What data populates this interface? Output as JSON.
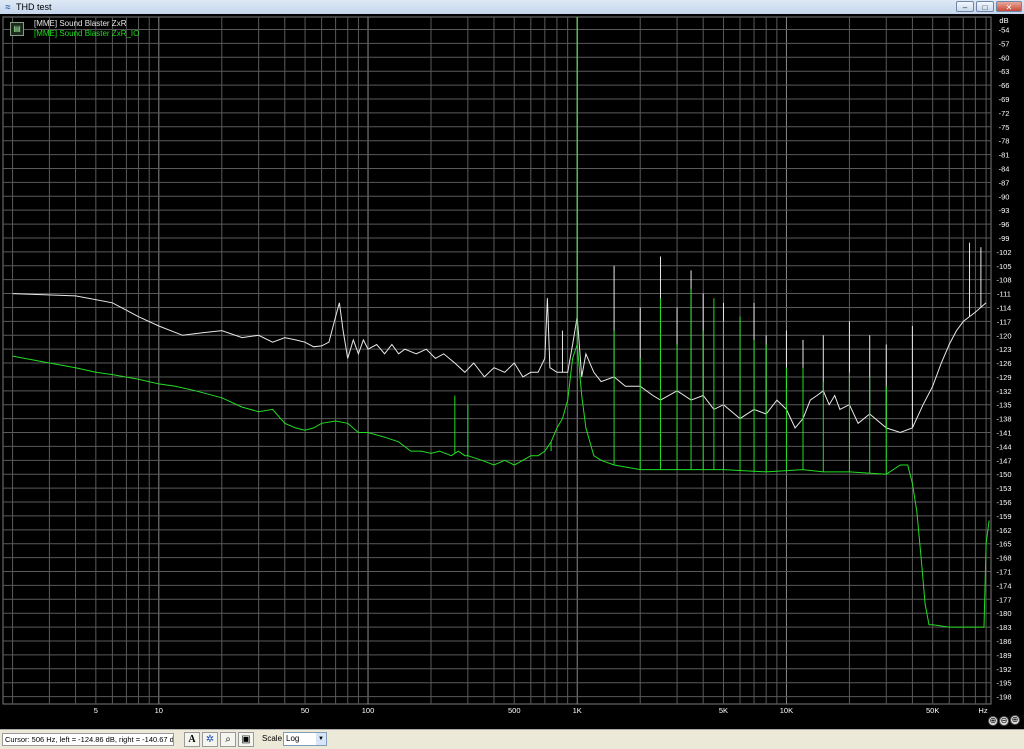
{
  "window": {
    "title": "THD test",
    "icon": "analyzer-icon",
    "controls": {
      "minimize": "–",
      "maximize": "□",
      "close": "✕"
    }
  },
  "legend": {
    "icon": "traces-icon",
    "entries": [
      {
        "label": "[MME] Sound Blaster ZxR",
        "color": "#e8e8e8"
      },
      {
        "label": "[MME] Sound Blaster ZxR_IO",
        "color": "#22dd22"
      }
    ]
  },
  "chart_data": {
    "type": "line",
    "title": "",
    "xlabel": "Hz",
    "ylabel": "dB",
    "xscale": "log",
    "xlim": [
      1.8,
      95000
    ],
    "ylim": [
      -199.6,
      -51.3
    ],
    "grid": true,
    "background": "#000000",
    "grid_color": "#5a5a5a",
    "x_tick_labels": [
      {
        "value": 5,
        "label": "5"
      },
      {
        "value": 10,
        "label": "10"
      },
      {
        "value": 50,
        "label": "50"
      },
      {
        "value": 100,
        "label": "100"
      },
      {
        "value": 500,
        "label": "500"
      },
      {
        "value": 1000,
        "label": "1K"
      },
      {
        "value": 5000,
        "label": "5K"
      },
      {
        "value": 10000,
        "label": "10K"
      },
      {
        "value": 50000,
        "label": "50K"
      }
    ],
    "x_unit_label": "Hz",
    "y_unit_label": "dB",
    "y_tick_labels": [
      "-54",
      "-57",
      "-60",
      "-63",
      "-66",
      "-69",
      "-72",
      "-75",
      "-78",
      "-81",
      "-84",
      "-87",
      "-90",
      "-93",
      "-96",
      "-99",
      "-102",
      "-105",
      "-108",
      "-111",
      "-114",
      "-117",
      "-120",
      "-123",
      "-126",
      "-129",
      "-132",
      "-135",
      "-138",
      "-141",
      "-144",
      "-147",
      "-150",
      "-153",
      "-156",
      "-159",
      "-162",
      "-165",
      "-168",
      "-171",
      "-174",
      "-177",
      "-180",
      "-183",
      "-186",
      "-189",
      "-192",
      "-195",
      "-198"
    ],
    "series": [
      {
        "name": "[MME] Sound Blaster ZxR",
        "color": "#e8e8e8",
        "points": [
          [
            2,
            -111.0
          ],
          [
            4,
            -111.5
          ],
          [
            6,
            -113
          ],
          [
            8,
            -116
          ],
          [
            10,
            -118
          ],
          [
            13,
            -120
          ],
          [
            16,
            -119.5
          ],
          [
            20,
            -119
          ],
          [
            25,
            -120.5
          ],
          [
            30,
            -120
          ],
          [
            35,
            -121.5
          ],
          [
            40,
            -120.5
          ],
          [
            45,
            -121
          ],
          [
            50,
            -121.5
          ],
          [
            55,
            -122.5
          ],
          [
            60,
            -122.3
          ],
          [
            65,
            -121.5
          ],
          [
            70,
            -116
          ],
          [
            73,
            -113
          ],
          [
            76,
            -119
          ],
          [
            80,
            -125
          ],
          [
            85,
            -121
          ],
          [
            90,
            -124
          ],
          [
            95,
            -121
          ],
          [
            100,
            -123
          ],
          [
            110,
            -122
          ],
          [
            120,
            -124
          ],
          [
            130,
            -122
          ],
          [
            140,
            -124
          ],
          [
            150,
            -123
          ],
          [
            170,
            -124
          ],
          [
            190,
            -123
          ],
          [
            210,
            -125
          ],
          [
            230,
            -124
          ],
          [
            260,
            -126
          ],
          [
            290,
            -128
          ],
          [
            320,
            -126
          ],
          [
            360,
            -129
          ],
          [
            400,
            -127
          ],
          [
            450,
            -128
          ],
          [
            500,
            -126
          ],
          [
            550,
            -129
          ],
          [
            600,
            -128
          ],
          [
            650,
            -128
          ],
          [
            700,
            -125
          ],
          [
            720,
            -112
          ],
          [
            740,
            -127
          ],
          [
            800,
            -128
          ],
          [
            900,
            -128
          ],
          [
            950,
            -122
          ],
          [
            1000,
            -116
          ],
          [
            1050,
            -129
          ],
          [
            1100,
            -124
          ],
          [
            1200,
            -128
          ],
          [
            1300,
            -130
          ],
          [
            1500,
            -129
          ],
          [
            1700,
            -131
          ],
          [
            2000,
            -131
          ],
          [
            2300,
            -133
          ],
          [
            2500,
            -134
          ],
          [
            3000,
            -132
          ],
          [
            3500,
            -134
          ],
          [
            4000,
            -133
          ],
          [
            4500,
            -136
          ],
          [
            5000,
            -135
          ],
          [
            6000,
            -138
          ],
          [
            7000,
            -136
          ],
          [
            8000,
            -137
          ],
          [
            9000,
            -134
          ],
          [
            10000,
            -136
          ],
          [
            11000,
            -140
          ],
          [
            12000,
            -138
          ],
          [
            13000,
            -134
          ],
          [
            14000,
            -133
          ],
          [
            15000,
            -132
          ],
          [
            16000,
            -135
          ],
          [
            17000,
            -133
          ],
          [
            18000,
            -136
          ],
          [
            20000,
            -135
          ],
          [
            22000,
            -139
          ],
          [
            25000,
            -137
          ],
          [
            30000,
            -140
          ],
          [
            35000,
            -141
          ],
          [
            40000,
            -140
          ],
          [
            45000,
            -135
          ],
          [
            50000,
            -131
          ],
          [
            55000,
            -126
          ],
          [
            60000,
            -122
          ],
          [
            65000,
            -119
          ],
          [
            70000,
            -117
          ],
          [
            80000,
            -115
          ],
          [
            90000,
            -113
          ]
        ],
        "spikes": [
          [
            720,
            -112
          ],
          [
            850,
            -119
          ],
          [
            1000,
            -51.3
          ],
          [
            1500,
            -105
          ],
          [
            2000,
            -114
          ],
          [
            2500,
            -103
          ],
          [
            3000,
            -114
          ],
          [
            3500,
            -106
          ],
          [
            4000,
            -111
          ],
          [
            5000,
            -113
          ],
          [
            6000,
            -116
          ],
          [
            7000,
            -113
          ],
          [
            8000,
            -120
          ],
          [
            10000,
            -119
          ],
          [
            12000,
            -121
          ],
          [
            15000,
            -120
          ],
          [
            20000,
            -117
          ],
          [
            25000,
            -120
          ],
          [
            30000,
            -122
          ],
          [
            40000,
            -118
          ],
          [
            75000,
            -100
          ],
          [
            85000,
            -101
          ]
        ]
      },
      {
        "name": "[MME] Sound Blaster ZxR_IO",
        "color": "#22dd22",
        "points": [
          [
            2,
            -124.5
          ],
          [
            3,
            -126
          ],
          [
            4,
            -127
          ],
          [
            5,
            -128
          ],
          [
            6,
            -128.5
          ],
          [
            8,
            -129.5
          ],
          [
            10,
            -130.5
          ],
          [
            12,
            -131
          ],
          [
            15,
            -132
          ],
          [
            20,
            -133.5
          ],
          [
            25,
            -135.5
          ],
          [
            30,
            -136.5
          ],
          [
            35,
            -136
          ],
          [
            40,
            -139
          ],
          [
            45,
            -140
          ],
          [
            50,
            -140.5
          ],
          [
            55,
            -140
          ],
          [
            60,
            -139
          ],
          [
            70,
            -138.5
          ],
          [
            80,
            -139
          ],
          [
            90,
            -141
          ],
          [
            100,
            -141
          ],
          [
            120,
            -142
          ],
          [
            140,
            -143
          ],
          [
            160,
            -145
          ],
          [
            180,
            -145
          ],
          [
            200,
            -145.5
          ],
          [
            220,
            -145
          ],
          [
            250,
            -146
          ],
          [
            270,
            -145
          ],
          [
            290,
            -146
          ],
          [
            300,
            -146
          ],
          [
            350,
            -147
          ],
          [
            400,
            -148
          ],
          [
            450,
            -147
          ],
          [
            500,
            -148
          ],
          [
            550,
            -147
          ],
          [
            600,
            -146
          ],
          [
            650,
            -146
          ],
          [
            700,
            -145
          ],
          [
            750,
            -143
          ],
          [
            800,
            -140
          ],
          [
            850,
            -138
          ],
          [
            900,
            -134
          ],
          [
            950,
            -125
          ],
          [
            1000,
            -122
          ],
          [
            1050,
            -133
          ],
          [
            1100,
            -140
          ],
          [
            1200,
            -146
          ],
          [
            1300,
            -147
          ],
          [
            1500,
            -148
          ],
          [
            2000,
            -149
          ],
          [
            3000,
            -149
          ],
          [
            5000,
            -149
          ],
          [
            8000,
            -149.5
          ],
          [
            12000,
            -149
          ],
          [
            15000,
            -149.5
          ],
          [
            20000,
            -149.5
          ],
          [
            30000,
            -150
          ],
          [
            35000,
            -148
          ],
          [
            38000,
            -148
          ],
          [
            40000,
            -152
          ],
          [
            42000,
            -158
          ],
          [
            44000,
            -168
          ],
          [
            46000,
            -178
          ],
          [
            48000,
            -182.5
          ],
          [
            50000,
            -182.5
          ],
          [
            60000,
            -183
          ],
          [
            70000,
            -183
          ],
          [
            80000,
            -183
          ],
          [
            88000,
            -183
          ],
          [
            90000,
            -165
          ],
          [
            93000,
            -160
          ]
        ],
        "spikes": [
          [
            260,
            -133
          ],
          [
            300,
            -135
          ],
          [
            750,
            -145
          ],
          [
            1000,
            -51.3
          ],
          [
            1500,
            -119
          ],
          [
            2000,
            -125
          ],
          [
            2500,
            -112
          ],
          [
            3000,
            -122
          ],
          [
            3500,
            -110
          ],
          [
            4000,
            -119
          ],
          [
            4500,
            -112
          ],
          [
            5000,
            -117
          ],
          [
            6000,
            -116
          ],
          [
            7000,
            -121
          ],
          [
            8000,
            -122
          ],
          [
            10000,
            -127
          ],
          [
            12000,
            -127
          ],
          [
            15000,
            -130
          ],
          [
            20000,
            -128
          ],
          [
            25000,
            -129
          ],
          [
            30000,
            -131
          ]
        ]
      }
    ]
  },
  "status": {
    "cursor_text": "Cursor:  506 Hz, left = -124.86 dB, right = -140.67 dB",
    "scale_label": "Scale",
    "scale_value": "Log",
    "toolbar_icons": [
      "font-icon",
      "color-settings-icon",
      "zoom-icon",
      "save-icon"
    ],
    "font_button_label": "A",
    "zoom_buttons": [
      "⊕",
      "⊖",
      "⊕",
      "⊖"
    ]
  }
}
